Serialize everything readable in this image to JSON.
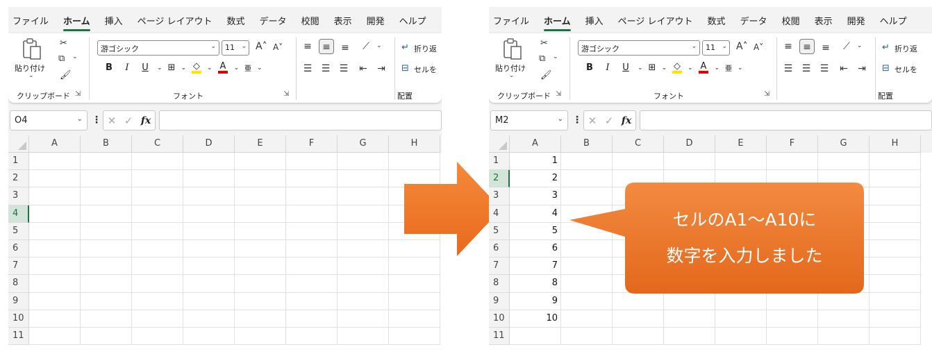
{
  "tabs": [
    "ファイル",
    "ホーム",
    "挿入",
    "ページ レイアウト",
    "数式",
    "データ",
    "校閲",
    "表示",
    "開発",
    "ヘルプ"
  ],
  "active_tab": "ホーム",
  "ribbon": {
    "clipboard_group": "クリップボード",
    "paste_label": "貼り付け",
    "font_group": "フォント",
    "font_name": "游ゴシック",
    "font_size": "11",
    "bold": "B",
    "italic": "I",
    "underline": "U",
    "font_color_letter": "A",
    "alignment_group": "配置",
    "wrap_text": "折り返",
    "wrap_text_right": "折り返",
    "merge_left": "セルを",
    "merge_right": "セルを"
  },
  "left": {
    "name_box": "O4",
    "selected_row": 4
  },
  "right": {
    "name_box": "M2",
    "selected_row": 2
  },
  "columns_left": [
    "A",
    "B",
    "C",
    "D",
    "E",
    "F",
    "G",
    "H"
  ],
  "columns_right": [
    "A",
    "B",
    "C",
    "D",
    "E",
    "F",
    "G",
    "H"
  ],
  "rows": [
    "1",
    "2",
    "3",
    "4",
    "5",
    "6",
    "7",
    "8",
    "9",
    "10",
    "11"
  ],
  "right_col_a_values": [
    "1",
    "2",
    "3",
    "4",
    "5",
    "6",
    "7",
    "8",
    "9",
    "10",
    ""
  ],
  "callout": {
    "line1": "セルのA1～A10に",
    "line2": "数字を入力しました"
  },
  "colors": {
    "accent_green": "#1e7145",
    "arrow_orange": "#f07c2a",
    "callout_orange": "#ea7224"
  }
}
